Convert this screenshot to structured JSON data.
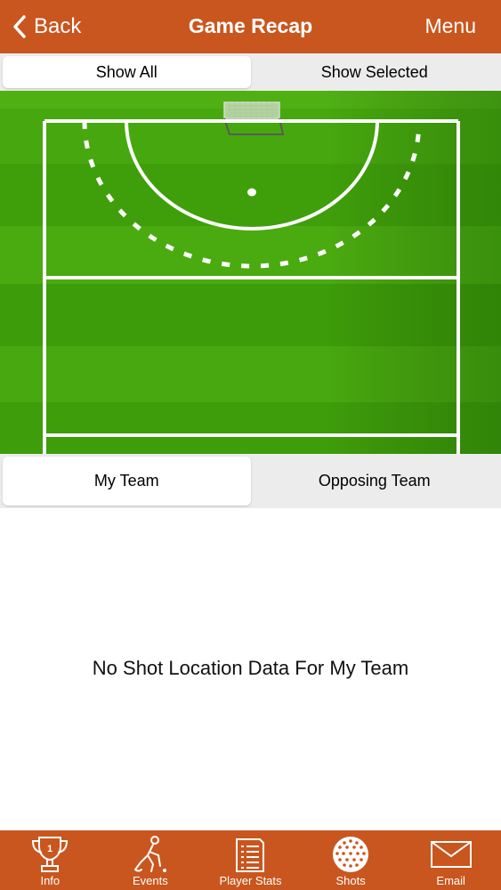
{
  "nav": {
    "back_label": "Back",
    "title": "Game Recap",
    "menu_label": "Menu"
  },
  "view_filter": {
    "options": [
      "Show All",
      "Show Selected"
    ],
    "selected": "Show All"
  },
  "team_filter": {
    "options": [
      "My Team",
      "Opposing Team"
    ],
    "selected": "My Team"
  },
  "empty_message": "No Shot Location Data For My Team",
  "tabs": [
    {
      "label": "Info",
      "icon": "trophy-icon"
    },
    {
      "label": "Events",
      "icon": "player-icon"
    },
    {
      "label": "Player Stats",
      "icon": "stats-sheet-icon"
    },
    {
      "label": "Shots",
      "icon": "ball-icon"
    },
    {
      "label": "Email",
      "icon": "envelope-icon"
    }
  ],
  "colors": {
    "brand": "#c9561e",
    "field_green": "#3f9e0a",
    "field_green_light": "#4aaa10",
    "segment_bg": "#ececec"
  }
}
